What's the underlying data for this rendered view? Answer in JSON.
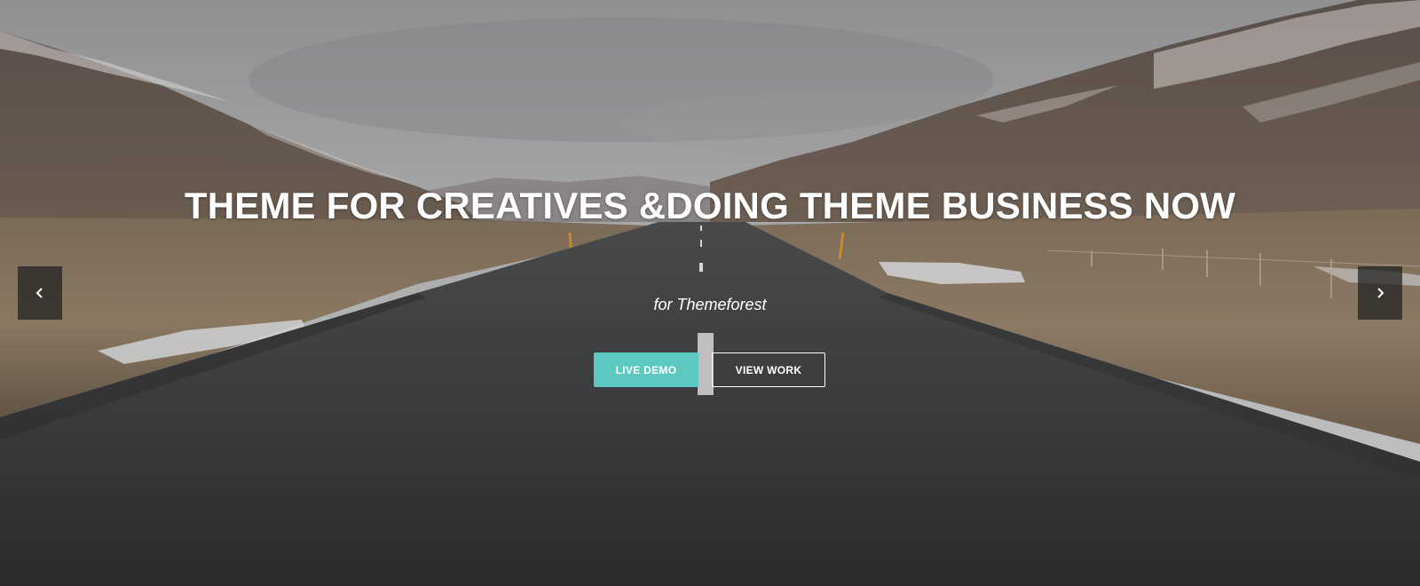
{
  "hero": {
    "headline": "THEME FOR CREATIVES &DOING THEME BUSINESS NOW",
    "subline": "for Themeforest",
    "live_demo_label": "LIVE DEMO",
    "view_work_label": "VIEW WORK",
    "prev_icon": "chevron-left-icon",
    "next_icon": "chevron-right-icon"
  },
  "colors": {
    "accent": "#5bc9c0",
    "sky": "#a9aaac",
    "road": "#3d3e40",
    "text": "#ffffff"
  }
}
